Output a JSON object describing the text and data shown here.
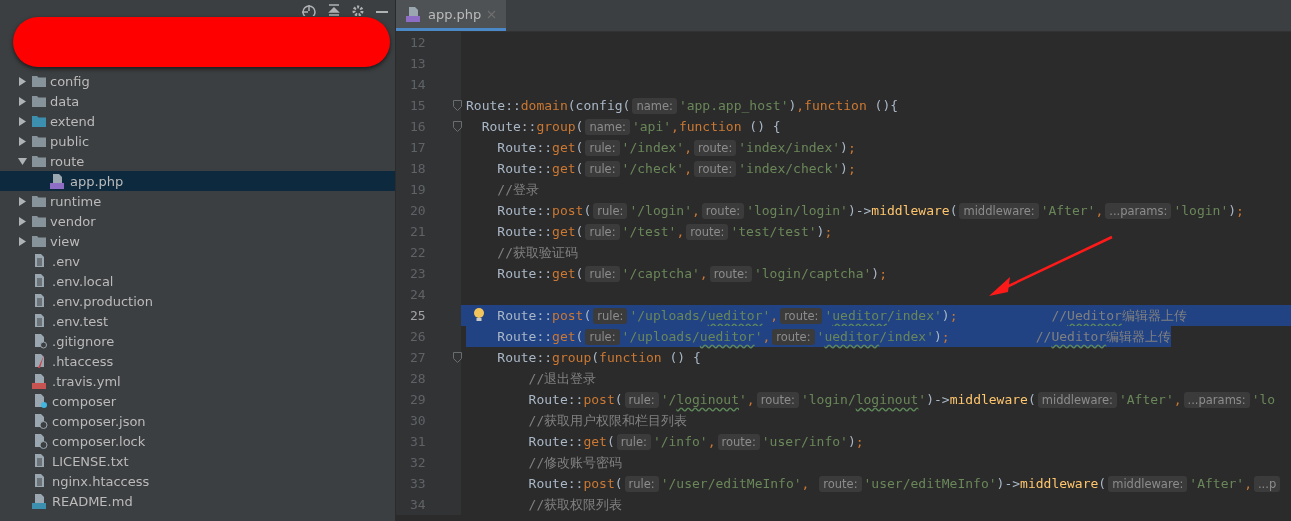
{
  "sidebar": {
    "items": [
      {
        "kind": "folder",
        "label": "config",
        "expanded": false,
        "selected": false
      },
      {
        "kind": "folder",
        "label": "data",
        "expanded": false,
        "selected": false
      },
      {
        "kind": "source-folder",
        "label": "extend",
        "expanded": false,
        "selected": false
      },
      {
        "kind": "folder",
        "label": "public",
        "expanded": false,
        "selected": false
      },
      {
        "kind": "folder",
        "label": "route",
        "expanded": true,
        "selected": false,
        "children": [
          {
            "kind": "php-file",
            "label": "app.php",
            "selected": true
          }
        ]
      },
      {
        "kind": "folder",
        "label": "runtime",
        "expanded": false,
        "selected": false
      },
      {
        "kind": "folder",
        "label": "vendor",
        "expanded": false,
        "selected": false
      },
      {
        "kind": "folder",
        "label": "view",
        "expanded": false,
        "selected": false
      },
      {
        "kind": "text-file",
        "label": ".env",
        "selected": false
      },
      {
        "kind": "text-file",
        "label": ".env.local",
        "selected": false
      },
      {
        "kind": "text-file",
        "label": ".env.production",
        "selected": false
      },
      {
        "kind": "text-file",
        "label": ".env.test",
        "selected": false
      },
      {
        "kind": "ignore-file",
        "label": ".gitignore",
        "selected": false
      },
      {
        "kind": "apache-file",
        "label": ".htaccess",
        "selected": false
      },
      {
        "kind": "yml-file",
        "label": ".travis.yml",
        "selected": false
      },
      {
        "kind": "unknown-file",
        "label": "composer",
        "selected": false
      },
      {
        "kind": "json-file",
        "label": "composer.json",
        "selected": false
      },
      {
        "kind": "json-file",
        "label": "composer.lock",
        "selected": false
      },
      {
        "kind": "text-file",
        "label": "LICENSE.txt",
        "selected": false
      },
      {
        "kind": "text-file",
        "label": "nginx.htaccess",
        "selected": false
      },
      {
        "kind": "md-file",
        "label": "README.md",
        "selected": false
      }
    ]
  },
  "tabs": [
    {
      "label": "app.php",
      "selected": true
    }
  ],
  "editor": {
    "lines": [
      {
        "number": "12",
        "current": false,
        "selected": false,
        "fold": false
      },
      {
        "number": "13",
        "current": false,
        "selected": false,
        "fold": false
      },
      {
        "number": "14",
        "current": false,
        "selected": false,
        "fold": false
      },
      {
        "number": "15",
        "current": false,
        "selected": false,
        "fold": true,
        "tokens": [
          {
            "kind": "text",
            "text": "Route::"
          },
          {
            "kind": "kw",
            "text": "domain"
          },
          {
            "kind": "text",
            "text": "(config("
          },
          {
            "kind": "hint",
            "text": "name:"
          },
          {
            "kind": "str",
            "text": "'app.app_host'"
          },
          {
            "kind": "text",
            "text": ")"
          },
          {
            "kind": "kw",
            "text": ",function"
          },
          {
            "kind": "text",
            "text": " (){"
          }
        ]
      },
      {
        "number": "16",
        "current": false,
        "selected": false,
        "fold": true,
        "tokens": [
          {
            "kind": "text",
            "text": "  Route::"
          },
          {
            "kind": "kw",
            "text": "group"
          },
          {
            "kind": "text",
            "text": "("
          },
          {
            "kind": "hint",
            "text": "name:"
          },
          {
            "kind": "str",
            "text": "'api'"
          },
          {
            "kind": "kw",
            "text": ",function"
          },
          {
            "kind": "text",
            "text": " () {"
          }
        ]
      },
      {
        "number": "17",
        "current": false,
        "selected": false,
        "fold": false,
        "tokens": [
          {
            "kind": "text",
            "text": "    Route::"
          },
          {
            "kind": "kw",
            "text": "get"
          },
          {
            "kind": "text",
            "text": "("
          },
          {
            "kind": "hint",
            "text": "rule:"
          },
          {
            "kind": "str",
            "text": "'/index'"
          },
          {
            "kind": "kw",
            "text": ","
          },
          {
            "kind": "hint",
            "text": "route:"
          },
          {
            "kind": "str",
            "text": "'index/index'"
          },
          {
            "kind": "text",
            "text": ")"
          },
          {
            "kind": "kw",
            "text": ";"
          }
        ]
      },
      {
        "number": "18",
        "current": false,
        "selected": false,
        "fold": false,
        "tokens": [
          {
            "kind": "text",
            "text": "    Route::"
          },
          {
            "kind": "kw",
            "text": "get"
          },
          {
            "kind": "text",
            "text": "("
          },
          {
            "kind": "hint",
            "text": "rule:"
          },
          {
            "kind": "str",
            "text": "'/check'"
          },
          {
            "kind": "kw",
            "text": ","
          },
          {
            "kind": "hint",
            "text": "route:"
          },
          {
            "kind": "str",
            "text": "'index/check'"
          },
          {
            "kind": "text",
            "text": ")"
          },
          {
            "kind": "kw",
            "text": ";"
          }
        ]
      },
      {
        "number": "19",
        "current": false,
        "selected": false,
        "fold": false,
        "tokens": [
          {
            "kind": "comment",
            "text": "    //登录"
          }
        ]
      },
      {
        "number": "20",
        "current": false,
        "selected": false,
        "fold": false,
        "tokens": [
          {
            "kind": "text",
            "text": "    Route::"
          },
          {
            "kind": "kw",
            "text": "post"
          },
          {
            "kind": "text",
            "text": "("
          },
          {
            "kind": "hint",
            "text": "rule:"
          },
          {
            "kind": "str",
            "text": "'/login'"
          },
          {
            "kind": "kw",
            "text": ","
          },
          {
            "kind": "hint",
            "text": "route:"
          },
          {
            "kind": "str",
            "text": "'login/login'"
          },
          {
            "kind": "text",
            "text": ")->"
          },
          {
            "kind": "fn",
            "text": "middleware"
          },
          {
            "kind": "text",
            "text": "("
          },
          {
            "kind": "hint",
            "text": "middleware:"
          },
          {
            "kind": "str",
            "text": "'After'"
          },
          {
            "kind": "kw",
            "text": ","
          },
          {
            "kind": "hint",
            "text": "...params:"
          },
          {
            "kind": "str",
            "text": "'login'"
          },
          {
            "kind": "text",
            "text": ")"
          },
          {
            "kind": "kw",
            "text": ";"
          }
        ]
      },
      {
        "number": "21",
        "current": false,
        "selected": false,
        "fold": false,
        "tokens": [
          {
            "kind": "text",
            "text": "    Route::"
          },
          {
            "kind": "kw",
            "text": "get"
          },
          {
            "kind": "text",
            "text": "("
          },
          {
            "kind": "hint",
            "text": "rule:"
          },
          {
            "kind": "str",
            "text": "'/test'"
          },
          {
            "kind": "kw",
            "text": ","
          },
          {
            "kind": "hint",
            "text": "route:"
          },
          {
            "kind": "str",
            "text": "'test/test'"
          },
          {
            "kind": "text",
            "text": ")"
          },
          {
            "kind": "kw",
            "text": ";"
          }
        ]
      },
      {
        "number": "22",
        "current": false,
        "selected": false,
        "fold": false,
        "tokens": [
          {
            "kind": "comment",
            "text": "    //获取验证码"
          }
        ]
      },
      {
        "number": "23",
        "current": false,
        "selected": false,
        "fold": false,
        "tokens": [
          {
            "kind": "text",
            "text": "    Route::"
          },
          {
            "kind": "kw",
            "text": "get"
          },
          {
            "kind": "text",
            "text": "("
          },
          {
            "kind": "hint",
            "text": "rule:"
          },
          {
            "kind": "str",
            "text": "'/captcha'"
          },
          {
            "kind": "kw",
            "text": ","
          },
          {
            "kind": "hint",
            "text": "route:"
          },
          {
            "kind": "str",
            "text": "'login/captcha'"
          },
          {
            "kind": "text",
            "text": ")"
          },
          {
            "kind": "kw",
            "text": ";"
          }
        ]
      },
      {
        "number": "24",
        "current": false,
        "selected": false,
        "fold": false
      },
      {
        "number": "25",
        "current": true,
        "selected": true,
        "fold": false,
        "tokens": [
          {
            "kind": "text",
            "text": "    Route::"
          },
          {
            "kind": "kw",
            "text": "post"
          },
          {
            "kind": "text",
            "text": "("
          },
          {
            "kind": "hint",
            "text": "rule:"
          },
          {
            "kind": "str",
            "text": "'/uploads/"
          },
          {
            "kind": "strsq",
            "text": "ueditor"
          },
          {
            "kind": "str",
            "text": "'"
          },
          {
            "kind": "kw",
            "text": ","
          },
          {
            "kind": "hint",
            "text": "route:"
          },
          {
            "kind": "str",
            "text": "'"
          },
          {
            "kind": "strsq",
            "text": "ueditor"
          },
          {
            "kind": "str",
            "text": "/index'"
          },
          {
            "kind": "text",
            "text": ")"
          },
          {
            "kind": "kw",
            "text": ";"
          },
          {
            "kind": "comment",
            "text": "            //"
          },
          {
            "kind": "commentsq",
            "text": "Ueditor"
          },
          {
            "kind": "comment",
            "text": "编辑器上传"
          }
        ]
      },
      {
        "number": "26",
        "current": false,
        "selected": true,
        "fold": false,
        "tokens": [
          {
            "kind": "text",
            "text": "    Route::"
          },
          {
            "kind": "kw",
            "text": "get"
          },
          {
            "kind": "text",
            "text": "("
          },
          {
            "kind": "hint",
            "text": "rule:"
          },
          {
            "kind": "str",
            "text": "'/uploads/"
          },
          {
            "kind": "strsq",
            "text": "ueditor"
          },
          {
            "kind": "str",
            "text": "'"
          },
          {
            "kind": "kw",
            "text": ","
          },
          {
            "kind": "hint",
            "text": "route:"
          },
          {
            "kind": "str",
            "text": "'"
          },
          {
            "kind": "strsq",
            "text": "ueditor"
          },
          {
            "kind": "str",
            "text": "/index'"
          },
          {
            "kind": "text",
            "text": ")"
          },
          {
            "kind": "kw",
            "text": ";"
          },
          {
            "kind": "comment",
            "text": "           //"
          },
          {
            "kind": "commentsq",
            "text": "Ueditor"
          },
          {
            "kind": "comment",
            "text": "编辑器上传"
          }
        ]
      },
      {
        "number": "27",
        "current": false,
        "selected": false,
        "fold": true,
        "tokens": [
          {
            "kind": "text",
            "text": "    Route::"
          },
          {
            "kind": "kw",
            "text": "group"
          },
          {
            "kind": "text",
            "text": "("
          },
          {
            "kind": "kw",
            "text": "function"
          },
          {
            "kind": "text",
            "text": " () {"
          }
        ]
      },
      {
        "number": "28",
        "current": false,
        "selected": false,
        "fold": false,
        "tokens": [
          {
            "kind": "comment",
            "text": "        //退出登录"
          }
        ]
      },
      {
        "number": "29",
        "current": false,
        "selected": false,
        "fold": false,
        "tokens": [
          {
            "kind": "text",
            "text": "        Route::"
          },
          {
            "kind": "kw",
            "text": "post"
          },
          {
            "kind": "text",
            "text": "("
          },
          {
            "kind": "hint",
            "text": "rule:"
          },
          {
            "kind": "str",
            "text": "'/"
          },
          {
            "kind": "strsq",
            "text": "loginout"
          },
          {
            "kind": "str",
            "text": "'"
          },
          {
            "kind": "kw",
            "text": ","
          },
          {
            "kind": "hint",
            "text": "route:"
          },
          {
            "kind": "str",
            "text": "'login/"
          },
          {
            "kind": "strsq",
            "text": "loginout"
          },
          {
            "kind": "str",
            "text": "'"
          },
          {
            "kind": "text",
            "text": ")->"
          },
          {
            "kind": "fn",
            "text": "middleware"
          },
          {
            "kind": "text",
            "text": "("
          },
          {
            "kind": "hint",
            "text": "middleware:"
          },
          {
            "kind": "str",
            "text": "'After'"
          },
          {
            "kind": "kw",
            "text": ","
          },
          {
            "kind": "hint",
            "text": "...params:"
          },
          {
            "kind": "str",
            "text": "'lo"
          }
        ]
      },
      {
        "number": "30",
        "current": false,
        "selected": false,
        "fold": false,
        "tokens": [
          {
            "kind": "comment",
            "text": "        //获取用户权限和栏目列表"
          }
        ]
      },
      {
        "number": "31",
        "current": false,
        "selected": false,
        "fold": false,
        "tokens": [
          {
            "kind": "text",
            "text": "        Route::"
          },
          {
            "kind": "kw",
            "text": "get"
          },
          {
            "kind": "text",
            "text": "("
          },
          {
            "kind": "hint",
            "text": "rule:"
          },
          {
            "kind": "str",
            "text": "'/info'"
          },
          {
            "kind": "kw",
            "text": ","
          },
          {
            "kind": "hint",
            "text": "route:"
          },
          {
            "kind": "str",
            "text": "'user/info'"
          },
          {
            "kind": "text",
            "text": ")"
          },
          {
            "kind": "kw",
            "text": ";"
          }
        ]
      },
      {
        "number": "32",
        "current": false,
        "selected": false,
        "fold": false,
        "tokens": [
          {
            "kind": "comment",
            "text": "        //修改账号密码"
          }
        ]
      },
      {
        "number": "33",
        "current": false,
        "selected": false,
        "fold": false,
        "tokens": [
          {
            "kind": "text",
            "text": "        Route::"
          },
          {
            "kind": "kw",
            "text": "post"
          },
          {
            "kind": "text",
            "text": "("
          },
          {
            "kind": "hint",
            "text": "rule:"
          },
          {
            "kind": "str",
            "text": "'/user/editMeInfo'"
          },
          {
            "kind": "kw",
            "text": ", "
          },
          {
            "kind": "hint",
            "text": "route:"
          },
          {
            "kind": "str",
            "text": "'user/editMeInfo'"
          },
          {
            "kind": "text",
            "text": ")->"
          },
          {
            "kind": "fn",
            "text": "middleware"
          },
          {
            "kind": "text",
            "text": "("
          },
          {
            "kind": "hint",
            "text": "middleware:"
          },
          {
            "kind": "str",
            "text": "'After'"
          },
          {
            "kind": "kw",
            "text": ","
          },
          {
            "kind": "hint",
            "text": "...p"
          }
        ]
      },
      {
        "number": "34",
        "current": false,
        "selected": false,
        "fold": false,
        "tokens": [
          {
            "kind": "comment",
            "text": "        //获取权限列表"
          }
        ]
      }
    ]
  }
}
